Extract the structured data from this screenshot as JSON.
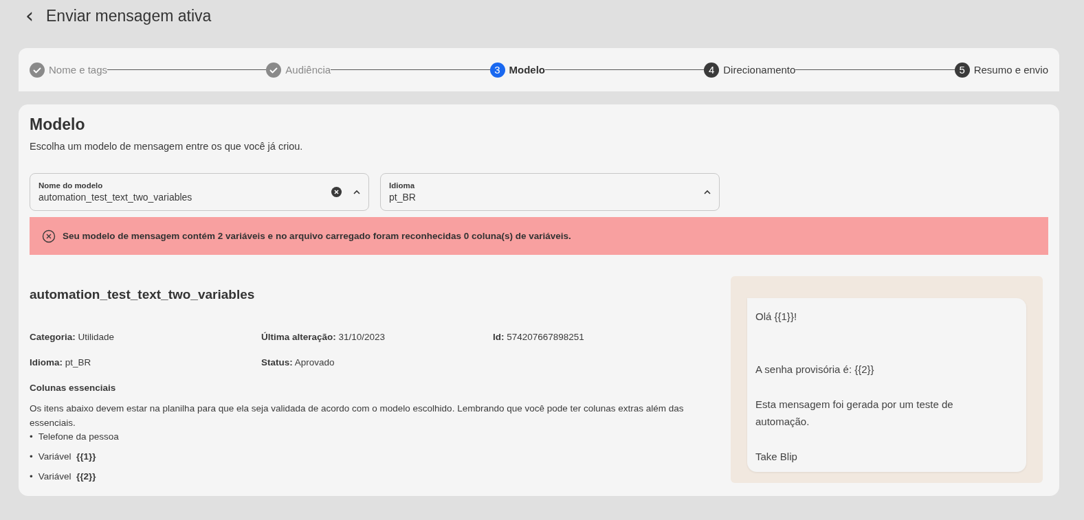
{
  "header": {
    "back": "‹",
    "title": "Enviar mensagem ativa"
  },
  "steps": [
    {
      "label": "Nome e tags",
      "completed": true,
      "selected": false
    },
    {
      "label": "Audiência",
      "completed": true,
      "selected": false
    },
    {
      "number": "3",
      "label": "Modelo",
      "completed": false,
      "selected": true
    },
    {
      "number": "4",
      "label": "Direcionamento",
      "completed": false,
      "selected": false
    },
    {
      "number": "5",
      "label": "Resumo e envio",
      "completed": false,
      "selected": false
    }
  ],
  "section": {
    "title": "Modelo",
    "subtitle": "Escolha um modelo de mensagem entre os que você já criou."
  },
  "selects": [
    {
      "label": "Nome do modelo",
      "value": "automation_test_text_two_variables",
      "clearable": true,
      "expanded": true
    },
    {
      "label": "Idioma",
      "value": "pt_BR",
      "clearable": false,
      "expanded": true
    }
  ],
  "alert": {
    "kind": "error",
    "text": "Seu modelo de mensagem contém 2 variáveis e no arquivo carregado foram reconhecidas 0 coluna(s) de variáveis."
  },
  "template": {
    "name": "automation_test_text_two_variables",
    "details": [
      {
        "label": "Categoria:",
        "value": "Utilidade"
      },
      {
        "label": "Última alteração:",
        "value": "31/10/2023"
      },
      {
        "label": "Id:",
        "value": "574207667898251"
      },
      {
        "label": "Idioma:",
        "value": "pt_BR"
      },
      {
        "label": "Status:",
        "value": "Aprovado"
      }
    ],
    "columns_title": "Colunas essenciais",
    "columns_text": "Os itens abaixo devem estar na planilha para que ela seja validada de acordo com o modelo escolhido. Lembrando que você pode ter colunas extras além das essenciais.",
    "columns": [
      {
        "bullet": "•",
        "text": "Telefone da pessoa"
      },
      {
        "bullet": "•",
        "text": "Variável  **{{1}}**"
      },
      {
        "bullet": "•",
        "text": "Variável  **{{2}}**"
      }
    ]
  },
  "preview": {
    "message": "Olá {{1}}!\n\n\nA senha provisória é: {{2}}\n\nEsta mensagem foi gerada por um teste de automação.\n\nTake Blip"
  }
}
